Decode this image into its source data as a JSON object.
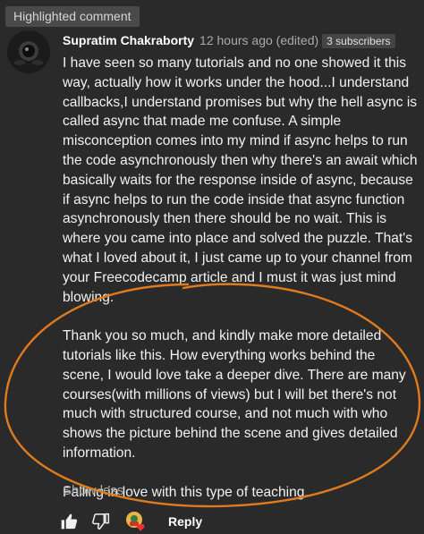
{
  "badge": {
    "label": "Highlighted comment"
  },
  "comment": {
    "author": "Supratim Chakraborty",
    "time": "12 hours ago (edited)",
    "subscribers": "3 subscribers",
    "paragraphs": [
      "I have seen  so many tutorials and no one showed it this way, actually how it works under the hood...I understand callbacks,I  understand promises but why the hell async is called async that made me confuse. A simple misconception comes into my mind if async helps to run the code asynchronously then why there's an await which basically waits for the response inside of async, because if async helps to run the code inside that async function asynchronously then there should be no wait. This is where you came into place and solved the puzzle. That's what I loved about it, I just came up to your channel from your Freecodecamp article and I must it was just mind blowing.",
      "Thank you so much, and kindly make more detailed tutorials like this. How everything works behind the scene, I would love take a deeper dive. There are many courses(with millions of views) but I will bet there's not much with structured course, and not much with who shows the picture behind the scene and gives detailed information.",
      "Falling in love with this type of teaching."
    ],
    "show_less": "Show less"
  },
  "actions": {
    "reply": "Reply",
    "like_icon": "thumb-up-icon",
    "dislike_icon": "thumb-down-icon",
    "heart_icon": "creator-heart-icon"
  },
  "colors": {
    "background": "#2a2a2a",
    "annotation": "#e07a1f",
    "heart": "#ff2d2d"
  }
}
